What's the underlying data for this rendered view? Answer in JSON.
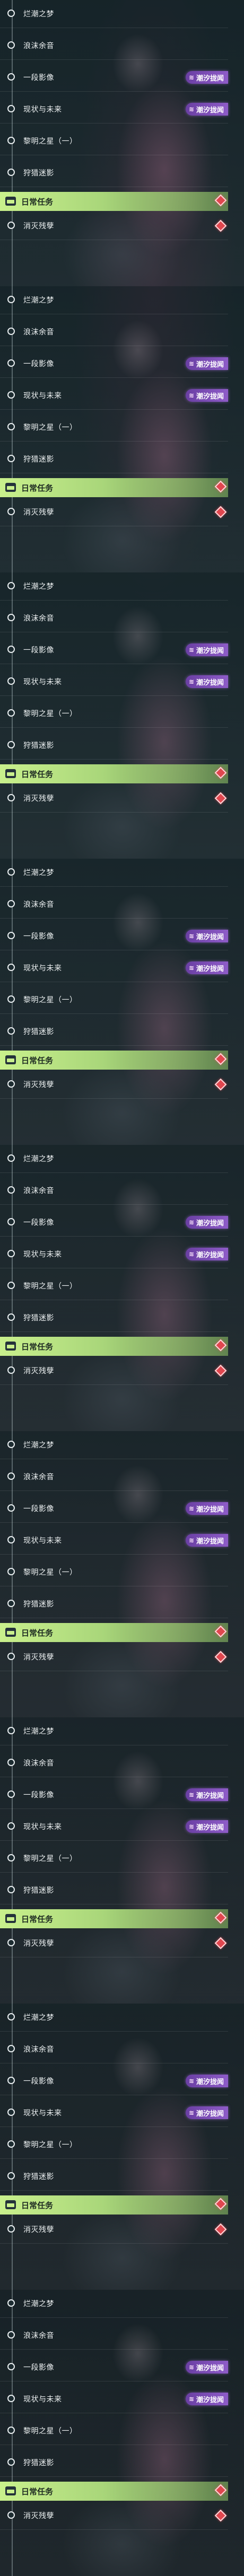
{
  "quest_log": {
    "panels": [
      {
        "items": [
          {
            "label": "烂潮之梦"
          },
          {
            "label": "浪沫余音"
          },
          {
            "label": "一段影像",
            "tag": "潮汐拢闻"
          },
          {
            "label": "现状与未来",
            "tag": "潮汐拢闻"
          },
          {
            "label": "黎明之星（一）"
          },
          {
            "label": "狩猎迷影"
          }
        ],
        "daily_header": "日常任务",
        "daily_items": [
          {
            "label": "消灭残孽"
          }
        ]
      },
      {
        "items": [
          {
            "label": "烂潮之梦"
          },
          {
            "label": "浪沫余音"
          },
          {
            "label": "一段影像",
            "tag": "潮汐拢闻"
          },
          {
            "label": "现状与未来",
            "tag": "潮汐拢闻"
          },
          {
            "label": "黎明之星（一）"
          },
          {
            "label": "狩猎迷影"
          }
        ],
        "daily_header": "日常任务",
        "daily_items": [
          {
            "label": "消灭残孽"
          }
        ]
      },
      {
        "items": [
          {
            "label": "烂潮之梦"
          },
          {
            "label": "浪沫余音"
          },
          {
            "label": "一段影像",
            "tag": "潮汐拢闻"
          },
          {
            "label": "现状与未来",
            "tag": "潮汐拢闻"
          },
          {
            "label": "黎明之星（一）"
          },
          {
            "label": "狩猎迷影"
          }
        ],
        "daily_header": "日常任务",
        "daily_items": [
          {
            "label": "消灭残孽"
          }
        ]
      },
      {
        "items": [
          {
            "label": "烂潮之梦"
          },
          {
            "label": "浪沫余音"
          },
          {
            "label": "一段影像",
            "tag": "潮汐拢闻"
          },
          {
            "label": "现状与未来",
            "tag": "潮汐拢闻"
          },
          {
            "label": "黎明之星（一）"
          },
          {
            "label": "狩猎迷影"
          }
        ],
        "daily_header": "日常任务",
        "daily_items": [
          {
            "label": "消灭残孽"
          }
        ]
      },
      {
        "items": [
          {
            "label": "烂潮之梦"
          },
          {
            "label": "浪沫余音"
          },
          {
            "label": "一段影像",
            "tag": "潮汐拢闻"
          },
          {
            "label": "现状与未来",
            "tag": "潮汐拢闻"
          },
          {
            "label": "黎明之星（一）"
          },
          {
            "label": "狩猎迷影"
          }
        ],
        "daily_header": "日常任务",
        "daily_items": [
          {
            "label": "消灭残孽"
          }
        ]
      },
      {
        "items": [
          {
            "label": "烂潮之梦"
          },
          {
            "label": "浪沫余音"
          },
          {
            "label": "一段影像",
            "tag": "潮汐拢闻"
          },
          {
            "label": "现状与未来",
            "tag": "潮汐拢闻"
          },
          {
            "label": "黎明之星（一）"
          },
          {
            "label": "狩猎迷影"
          }
        ],
        "daily_header": "日常任务",
        "daily_items": [
          {
            "label": "消灭残孽"
          }
        ]
      },
      {
        "items": [
          {
            "label": "烂潮之梦"
          },
          {
            "label": "浪沫余音"
          },
          {
            "label": "一段影像",
            "tag": "潮汐拢闻"
          },
          {
            "label": "现状与未来",
            "tag": "潮汐拢闻"
          },
          {
            "label": "黎明之星（一）"
          },
          {
            "label": "狩猎迷影"
          }
        ],
        "daily_header": "日常任务",
        "daily_items": [
          {
            "label": "消灭残孽"
          }
        ]
      },
      {
        "items": [
          {
            "label": "烂潮之梦"
          },
          {
            "label": "浪沫余音"
          },
          {
            "label": "一段影像",
            "tag": "潮汐拢闻"
          },
          {
            "label": "现状与未来",
            "tag": "潮汐拢闻"
          },
          {
            "label": "黎明之星（一）"
          },
          {
            "label": "狩猎迷影"
          }
        ],
        "daily_header": "日常任务",
        "daily_items": [
          {
            "label": "消灭残孽"
          }
        ]
      },
      {
        "items": [
          {
            "label": "烂潮之梦"
          },
          {
            "label": "浪沫余音"
          },
          {
            "label": "一段影像",
            "tag": "潮汐拢闻"
          },
          {
            "label": "现状与未来",
            "tag": "潮汐拢闻"
          },
          {
            "label": "黎明之星（一）"
          },
          {
            "label": "狩猎迷影"
          }
        ],
        "daily_header": "日常任务",
        "daily_items": [
          {
            "label": "消灭残孽"
          }
        ]
      }
    ]
  },
  "icons": {
    "quest_dot": "ring-dot-icon",
    "tag": "wave-icon",
    "daily": "calendar-icon",
    "daily_item": "gem-icon"
  },
  "colors": {
    "tag_bg": "#8e5cc8",
    "daily_header_bg": "#c9f08c",
    "gem": "#e0474f"
  }
}
